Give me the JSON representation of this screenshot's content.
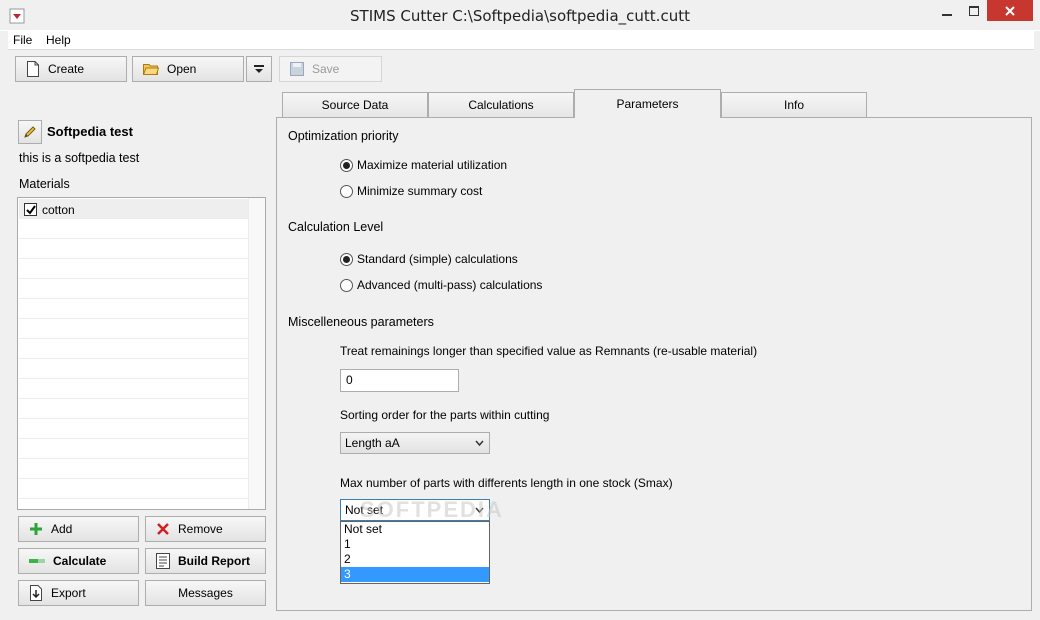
{
  "window": {
    "title": "STIMS Cutter  C:\\Softpedia\\softpedia_cutt.cutt"
  },
  "menu": {
    "file": "File",
    "help": "Help"
  },
  "toolbar": {
    "create": "Create",
    "open": "Open",
    "save": "Save"
  },
  "project": {
    "name": "Softpedia test",
    "description": "this is a softpedia test"
  },
  "materials": {
    "label": "Materials",
    "items": [
      {
        "name": "cotton",
        "checked": true
      }
    ]
  },
  "left_buttons": {
    "add": "Add",
    "remove": "Remove",
    "calculate": "Calculate",
    "build_report": "Build Report",
    "export": "Export",
    "messages": "Messages"
  },
  "tabs": [
    {
      "label": "Source Data"
    },
    {
      "label": "Calculations"
    },
    {
      "label": "Parameters",
      "active": true
    },
    {
      "label": "Info"
    }
  ],
  "parameters": {
    "opt_priority": {
      "heading": "Optimization priority",
      "options": [
        "Maximize material utilization",
        "Minimize summary cost"
      ],
      "selected": 0
    },
    "calc_level": {
      "heading": "Calculation Level",
      "options": [
        "Standard (simple) calculations",
        "Advanced (multi-pass) calculations"
      ],
      "selected": 0
    },
    "misc": {
      "heading": "Miscelleneous parameters",
      "remnants_label": "Treat remainings longer than specified value as Remnants (re-usable material)",
      "remnants_value": "0",
      "sort_label": "Sorting order for the parts within cutting",
      "sort_value": "Length aA",
      "smax_label": "Max number of parts with differents length in one stock (Smax)",
      "smax_value": "Not set",
      "smax_options": [
        "Not set",
        "1",
        "2",
        "3"
      ],
      "smax_highlighted": "3"
    }
  },
  "watermark": "SOFTPEDIA",
  "colors": {
    "highlight": "#3399ff",
    "close_button": "#c7372f"
  }
}
